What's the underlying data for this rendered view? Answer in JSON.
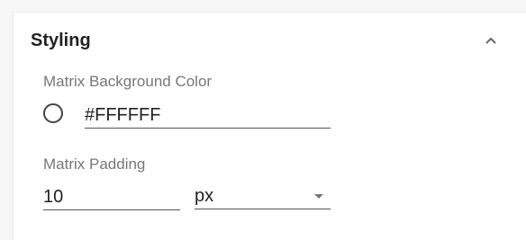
{
  "section": {
    "title": "Styling"
  },
  "matrix_background": {
    "label": "Matrix Background Color",
    "value": "#FFFFFF",
    "swatch_color": "#FFFFFF"
  },
  "matrix_padding": {
    "label": "Matrix Padding",
    "value": "10",
    "unit": "px"
  },
  "icons": {
    "collapse": "chevron-up-icon",
    "dropdown": "caret-down-icon",
    "swatch": "color-swatch"
  }
}
